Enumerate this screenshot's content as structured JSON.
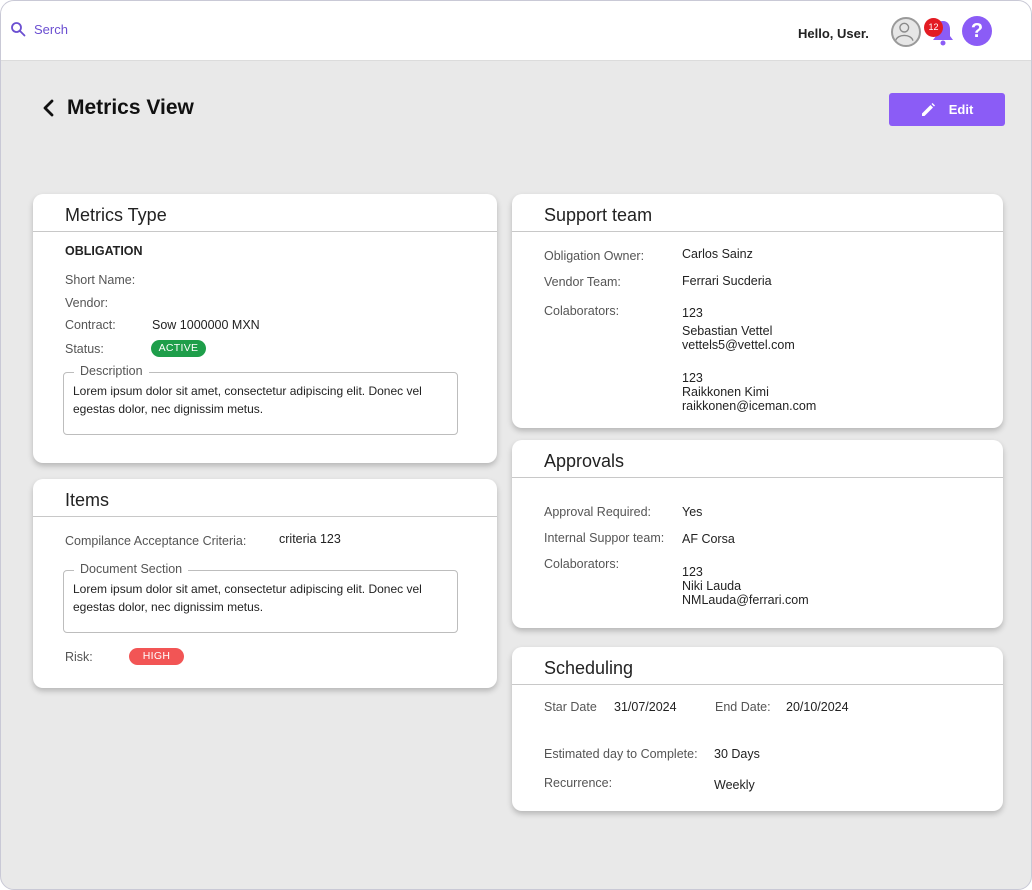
{
  "topbar": {
    "search_label": "Serch",
    "greeting": "Hello, User.",
    "notification_count": "12",
    "help_label": "?"
  },
  "page": {
    "title": "Metrics View",
    "edit_label": "Edit"
  },
  "metrics_type": {
    "title": "Metrics Type",
    "heading": "OBLIGATION",
    "short_name_label": "Short Name:",
    "vendor_label": "Vendor:",
    "contract_label": "Contract:",
    "contract_value": "Sow 1000000 MXN",
    "status_label": "Status:",
    "status_value": "ACTIVE",
    "description_legend": "Description",
    "description_text": "Lorem ipsum dolor sit amet, consectetur adipiscing elit. Donec vel egestas dolor, nec dignissim metus."
  },
  "items": {
    "title": "Items",
    "criteria_label": "Compilance Acceptance Criteria:",
    "criteria_value": "criteria 123",
    "document_legend": "Document Section",
    "document_text": "Lorem ipsum dolor sit amet, consectetur adipiscing elit. Donec vel egestas dolor, nec dignissim metus.",
    "risk_label": "Risk:",
    "risk_value": "HIGH"
  },
  "support_team": {
    "title": "Support team",
    "owner_label": "Obligation Owner:",
    "owner_value": "Carlos Sainz",
    "vendor_team_label": "Vendor Team:",
    "vendor_team_value": "Ferrari Sucderia",
    "collaborators_label": "Colaborators:",
    "collaborators": [
      {
        "id": "123",
        "name": "Sebastian Vettel",
        "email": "vettels5@vettel.com"
      },
      {
        "id": "123",
        "name": "Raikkonen Kimi",
        "email": "raikkonen@iceman.com"
      }
    ]
  },
  "approvals": {
    "title": "Approvals",
    "required_label": "Approval Required:",
    "required_value": "Yes",
    "internal_label": "Internal Suppor team:",
    "internal_value": "AF Corsa",
    "collaborators_label": "Colaborators:",
    "collaborator": {
      "id": "123",
      "name": "Niki Lauda",
      "email": "NMLauda@ferrari.com"
    }
  },
  "scheduling": {
    "title": "Scheduling",
    "start_label": "Star Date",
    "start_value": "31/07/2024",
    "end_label": "End Date:",
    "end_value": "20/10/2024",
    "estimated_label": "Estimated day to Complete:",
    "estimated_value": "30 Days",
    "recurrence_label": "Recurrence:",
    "recurrence_value": "Weekly"
  },
  "colors": {
    "accent": "#8b5cf6",
    "active": "#1e9e4a",
    "high": "#f25555",
    "badge": "#e31b23"
  },
  "icons": [
    "search-icon",
    "user-avatar-icon",
    "bell-icon",
    "help-icon",
    "chevron-left-icon",
    "pencil-icon"
  ]
}
